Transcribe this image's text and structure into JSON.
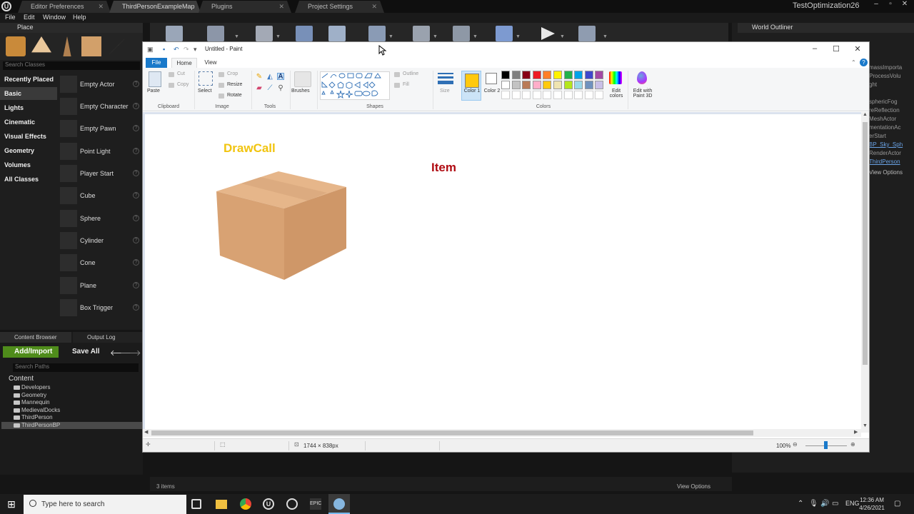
{
  "ue": {
    "tabs": [
      "Editor Preferences",
      "ThirdPersonExampleMap",
      "Plugins",
      "Project Settings"
    ],
    "project_title": "TestOptimization26",
    "menu": [
      "File",
      "Edit",
      "Window",
      "Help"
    ],
    "place_panel": {
      "title": "Place",
      "search_placeholder": "Search Classes",
      "categories": [
        "Recently Placed",
        "Basic",
        "Lights",
        "Cinematic",
        "Visual Effects",
        "Geometry",
        "Volumes",
        "All Classes"
      ],
      "selected_category": "Basic",
      "assets": [
        "Empty Actor",
        "Empty Character",
        "Empty Pawn",
        "Point Light",
        "Player Start",
        "Cube",
        "Sphere",
        "Cylinder",
        "Cone",
        "Plane",
        "Box Trigger"
      ]
    },
    "content_browser": {
      "tab": "Content Browser",
      "output_tab": "Output Log",
      "add_import": "Add/Import",
      "save_all": "Save All",
      "search_placeholder": "Search Paths",
      "root": "Content",
      "folders": [
        "Developers",
        "Geometry",
        "Mannequin",
        "MedievalDocks",
        "ThirdPerson",
        "ThirdPersonBP"
      ],
      "selected_folder": "ThirdPersonBP",
      "items_count": "3 items",
      "view_options": "View Options"
    },
    "world_outliner": {
      "title": "World Outliner",
      "items": [
        "massImporta",
        "ProcessVolu",
        "ght",
        "sphericFog",
        "reReflection",
        "MeshActor",
        "mentationAc",
        "erStart",
        "BP_Sky_Sph",
        "RenderActor",
        "ThirdPerson"
      ],
      "view_options": "View Options"
    }
  },
  "paint": {
    "title": "Untitled - Paint",
    "tabs": {
      "file": "File",
      "home": "Home",
      "view": "View"
    },
    "clipboard": {
      "paste": "Paste",
      "cut": "Cut",
      "copy": "Copy",
      "label": "Clipboard"
    },
    "image": {
      "select": "Select",
      "crop": "Crop",
      "resize": "Resize",
      "rotate": "Rotate",
      "label": "Image"
    },
    "tools_label": "Tools",
    "brushes": "Brushes",
    "shapes": {
      "outline": "Outline",
      "fill": "Fill",
      "label": "Shapes"
    },
    "size": "Size",
    "color1": "Color 1",
    "color2": "Color 2",
    "colors_label": "Colors",
    "edit_colors": "Edit colors",
    "edit_paint3d": "Edit with Paint 3D",
    "palette_row1": [
      "#000000",
      "#7f7f7f",
      "#880015",
      "#ed1c24",
      "#ff7f27",
      "#fff200",
      "#22b14c",
      "#00a2e8",
      "#3f48cc",
      "#a349a4"
    ],
    "palette_row2": [
      "#ffffff",
      "#c3c3c3",
      "#b97a57",
      "#ffaec9",
      "#ffc90e",
      "#efe4b0",
      "#b5e61d",
      "#99d9ea",
      "#7092be",
      "#c8bfe7"
    ],
    "canvas": {
      "drawcall": "DrawCall",
      "item": "Item"
    },
    "status": {
      "dimensions": "1744 × 838px",
      "zoom": "100%"
    }
  },
  "taskbar": {
    "search_placeholder": "Type here to search",
    "lang": "ENG",
    "time": "12:36 AM",
    "date": "4/26/2021"
  }
}
